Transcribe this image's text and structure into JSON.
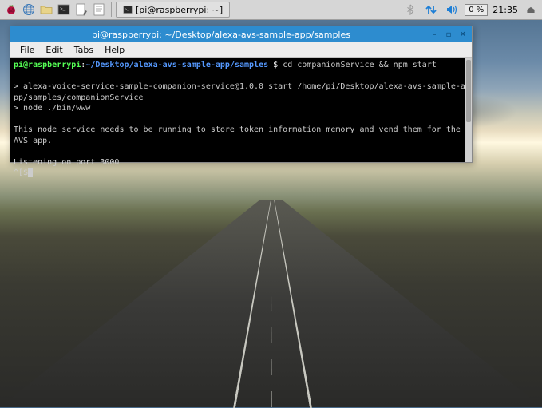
{
  "taskbar": {
    "window_button_label": "[pi@raspberrypi: ~]",
    "cpu_usage": "0 %",
    "clock": "21:35",
    "icons": {
      "menu": "raspberry-icon",
      "web": "globe-icon",
      "files": "folder-icon",
      "terminal": "terminal-icon",
      "editor1": "editor-icon",
      "editor2": "note-icon"
    },
    "tray": {
      "bluetooth": "bluetooth-icon",
      "network": "network-updown-icon",
      "volume": "volume-icon",
      "eject": "eject-icon"
    }
  },
  "terminal_window": {
    "title": "pi@raspberrypi: ~/Desktop/alexa-avs-sample-app/samples",
    "menu": {
      "file": "File",
      "edit": "Edit",
      "tabs": "Tabs",
      "help": "Help"
    },
    "window_controls": {
      "minimize": "–",
      "maximize": "▫",
      "close": "✕"
    },
    "prompt": {
      "user_host": "pi@raspberrypi",
      "path": "~/Desktop/alexa-avs-sample-app/samples",
      "symbol": "$",
      "command": "cd companionService && npm start"
    },
    "output": {
      "line1": "> alexa-voice-service-sample-companion-service@1.0.0 start /home/pi/Desktop/alexa-avs-sample-app/samples/companionService",
      "line2": "> node ./bin/www",
      "line3": "This node service needs to be running to store token information memory and vend them for the AVS app.",
      "line4": "Listening on port 3000",
      "line5": "^[$"
    }
  }
}
